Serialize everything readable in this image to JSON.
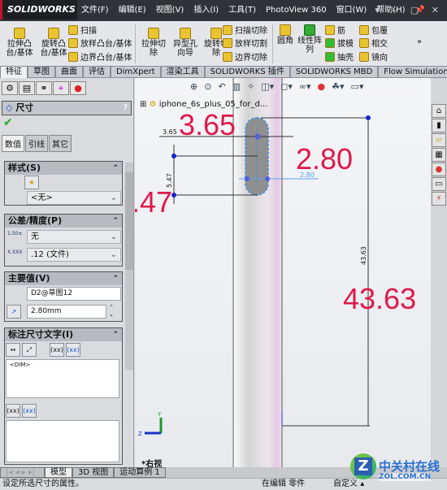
{
  "app": {
    "logo": "SOLIDWORKS",
    "menu": [
      "文件(F)",
      "编辑(E)",
      "视图(V)",
      "插入(I)",
      "工具(T)",
      "PhotoView 360",
      "窗口(W)",
      "帮助(H)"
    ],
    "window_controls": "▾ ‒ ▢ ✕"
  },
  "ribbon": {
    "large": [
      "拉伸凸台/基体",
      "旋转凸台/基体",
      "拉伸切除",
      "异型孔向导",
      "旋转切除",
      "圆角",
      "线性阵列"
    ],
    "small": [
      "扫描",
      "放样凸台/基体",
      "边界凸台/基体",
      "扫描切除",
      "放样切割",
      "边界切除",
      "筋",
      "拔模",
      "抽壳",
      "包覆",
      "相交",
      "镜向"
    ],
    "more": "»"
  },
  "cmd_tabs": [
    "特征",
    "草图",
    "曲面",
    "评估",
    "DimXpert",
    "渲染工具",
    "SOLIDWORKS 插件",
    "SOLIDWORKS MBD",
    "Flow Simulation"
  ],
  "panel": {
    "title": "尺寸",
    "help": "?",
    "ok": "✔",
    "tabs": [
      "数值",
      "引线",
      "其它"
    ],
    "style": {
      "header": "样式(S)",
      "value": "<无>"
    },
    "tolerance": {
      "header": "公差/精度(P)",
      "tolerance_type": "无",
      "precision": ".12 (文件)"
    },
    "primary": {
      "header": "主要值(V)",
      "name": "D2@草图12",
      "value": "2.80mm"
    },
    "dimtext": {
      "header": "标注尺寸文字(I)",
      "text": "<DIM>",
      "btn_xx": "(xx)"
    }
  },
  "viewport": {
    "tree_item": "iphone_6s_plus_05_for_d...",
    "dims": {
      "top": "3.65",
      "left": "5.47",
      "slot": "2.80",
      "height": "43.63"
    },
    "callouts": {
      "top": "3.65",
      "slot": "2.80",
      "left": "5.47",
      "height": "43.63",
      "color": "#e0194a"
    },
    "view_name": "*右视",
    "axes": {
      "y": "Y",
      "z": "Z"
    }
  },
  "bottom_tabs": [
    "模型",
    "3D 视图",
    "运动算例 1"
  ],
  "status": {
    "hint": "设定所选尺寸的属性。",
    "mode": "在编辑 零件",
    "custom": "自定义",
    "custom_arrow": "▴"
  },
  "watermark": {
    "cn": "中关村在线",
    "en": "ZOL.COM.CN"
  }
}
